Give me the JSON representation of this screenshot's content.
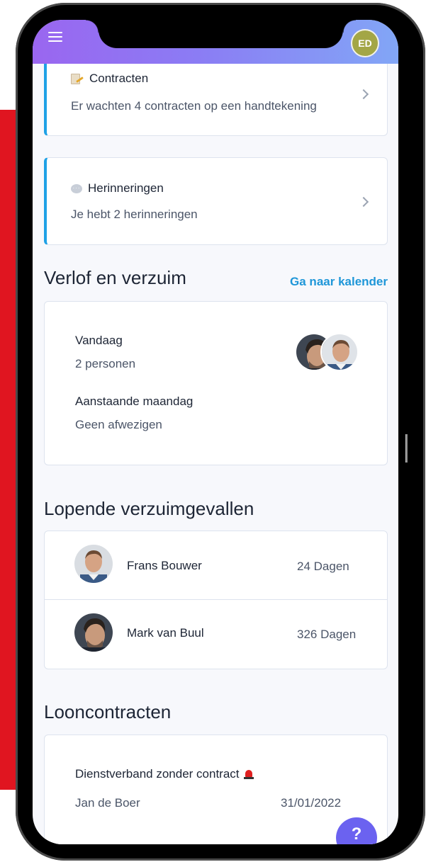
{
  "topbar": {
    "avatar_initials": "ED",
    "gradient": [
      "#9a66f0",
      "#82a6f6"
    ]
  },
  "notifications": [
    {
      "icon": "contract-document-icon",
      "title": "Contracten",
      "subtitle": "Er wachten 4 contracten op een handtekening"
    },
    {
      "icon": "chat-bubble-icon",
      "title": "Herinneringen",
      "subtitle": "Je hebt 2 herinneringen"
    }
  ],
  "leave": {
    "title": "Verlof en verzuim",
    "calendar_link": "Ga naar kalender",
    "today_label": "Vandaag",
    "today_value": "2 personen",
    "monday_label": "Aanstaande maandag",
    "monday_value": "Geen afwezigen"
  },
  "absence": {
    "title": "Lopende verzuimgevallen",
    "rows": [
      {
        "name": "Frans Bouwer",
        "days": "24 Dagen"
      },
      {
        "name": "Mark van Buul",
        "days": "326 Dagen"
      }
    ]
  },
  "payroll": {
    "title": "Looncontracten",
    "item_title": "Dienstverband zonder contract",
    "item_person": "Jan de Boer",
    "item_date": "31/01/2022"
  },
  "help": {
    "label": "?"
  },
  "colors": {
    "accent": "#1ea1e6",
    "link": "#1e96d8",
    "help_button": "#6b62f0",
    "avatar": "#a3a646",
    "side_bar": "#e01520"
  }
}
